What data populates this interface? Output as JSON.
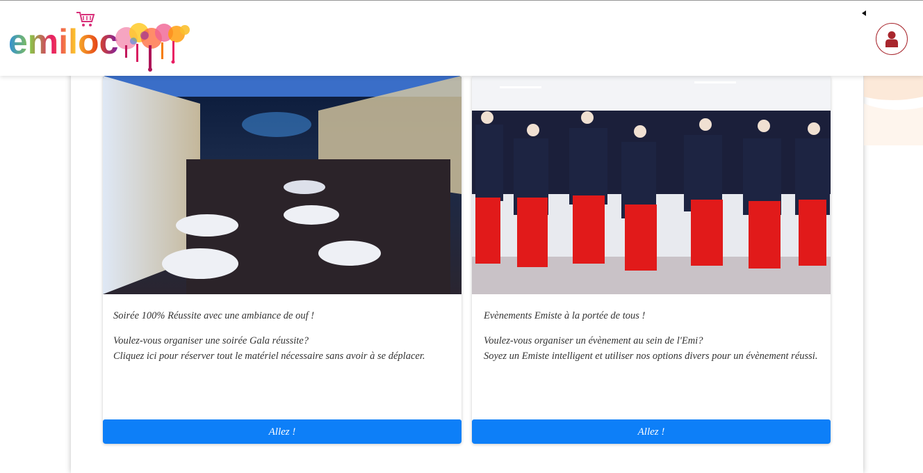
{
  "header": {
    "logo_text": "emiloc",
    "user_button": "user-icon"
  },
  "cards": [
    {
      "title": "Soirée 100% Réussite avec une ambiance de ouf !",
      "line1": "Voulez-vous organiser une soirée Gala réussite?",
      "line2": "Cliquez ici pour réserver tout le matériel nécessaire sans avoir à se déplacer.",
      "button": "Allez !"
    },
    {
      "title": "Evènements Emiste à la portée de tous !",
      "line1": "Voulez-vous organiser un évènement au sein de l'Emi?",
      "line2": "Soyez un Emiste intelligent et utiliser nos options divers pour un évènement réussi.",
      "button": "Allez !"
    }
  ],
  "colors": {
    "primary_button": "#0d7ff8",
    "user_icon": "#a8262d"
  }
}
